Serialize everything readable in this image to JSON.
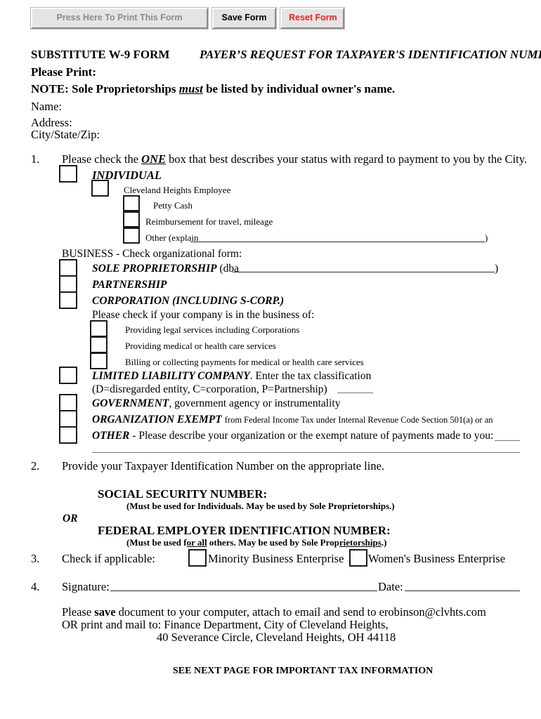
{
  "toolbar": {
    "print_label": "Press Here To Print This Form",
    "save_label": "Save Form",
    "reset_label": "Reset Form",
    "print_color": "#8b8b8b",
    "save_color": "#000000",
    "reset_color": "#ff1a1a"
  },
  "header": {
    "form_title": "SUBSTITUTE W-9 FORM",
    "form_subtitle": "PAYER’S REQUEST FOR TAXPAYER'S IDENTIFICATION NUMBER",
    "please_print": "Please Print:",
    "note_prefix": "NOTE: Sole Proprietorships ",
    "note_emphasis": "must",
    "note_suffix": " be listed by individual owner's name.",
    "name_label": "Name:",
    "address_label": "Address:",
    "city_state_zip_label": "City/State/Zip:"
  },
  "section1": {
    "number": "1.",
    "instruction_before": "Please check the ",
    "instruction_emphasis": "ONE",
    "instruction_after": " box that best describes your status with regard to payment to you by the City.",
    "individual_label": "INDIVIDUAL",
    "individual_options": [
      "Cleveland Heights Employee",
      "Petty Cash",
      "Reimbursement for travel, mileage",
      "Other (explain"
    ],
    "other_close_paren": ")",
    "business_header": "BUSINESS - Check organizational form:",
    "sole_proprietorship_label": "SOLE PROPRIETORSHIP",
    "sole_proprietorship_dba": "(dba",
    "sole_proprietorship_close": ")",
    "partnership_label": "PARTNERSHIP",
    "corporation_label": "CORPORATION (INCLUDING S-CORP.)",
    "business_of_header": "Please check if your company is in the business of:",
    "business_of_options": [
      "Providing legal services including Corporations",
      "Providing medical or health care services",
      "Billing or collecting payments for medical or health care services"
    ],
    "llc_label": "LIMITED LIABILITY COMPANY",
    "llc_text": ". Enter the tax classification",
    "llc_line2": "(D=disregarded entity, C=corporation, P=Partnership)",
    "government_label": "GOVERNMENT",
    "government_text": ", government agency or instrumentality",
    "org_exempt_label": "ORGANIZATION EXEMPT",
    "org_exempt_text": "from Federal Income Tax under Internal Revenue Code Section 501(a) or an",
    "other_label": "OTHER",
    "other_text": "- Please describe your organization or the exempt nature of payments made to you:"
  },
  "section2": {
    "number": "2.",
    "instruction": "Provide your Taxpayer Identification Number on the appropriate line.",
    "ssn_label": "SOCIAL SECURITY NUMBER:",
    "ssn_note": "(Must be used for Individuals.    May be used by Sole Proprietorships.)",
    "or_label": "OR",
    "ein_label": "FEDERAL EMPLOYER IDENTIFICATION NUMBER:",
    "ein_note_a": "(Must be used f",
    "ein_note_b": "or all",
    "ein_note_c": " others.    May be used by Sole Prop",
    "ein_note_d": "rietorships",
    "ein_note_e": ".)"
  },
  "section3": {
    "number": "3.",
    "label": "Check if applicable:",
    "minority_label": "Minority Business Enterprise",
    "women_label": "Women's Business Enterprise"
  },
  "section4": {
    "number": "4.",
    "signature_label": "Signature:",
    "date_label": "Date:"
  },
  "footer": {
    "line1_before": "Please ",
    "line1_emphasis": "save",
    "line1_after": " document to your computer, attach to email and send to erobinson@clvhts.com",
    "line2": "OR print and mail to:  Finance Department, City of Cleveland Heights,",
    "line3": "40 Severance Circle, Cleveland Heights, OH 44118",
    "notice": "SEE NEXT PAGE FOR IMPORTANT TAX INFORMATION"
  }
}
